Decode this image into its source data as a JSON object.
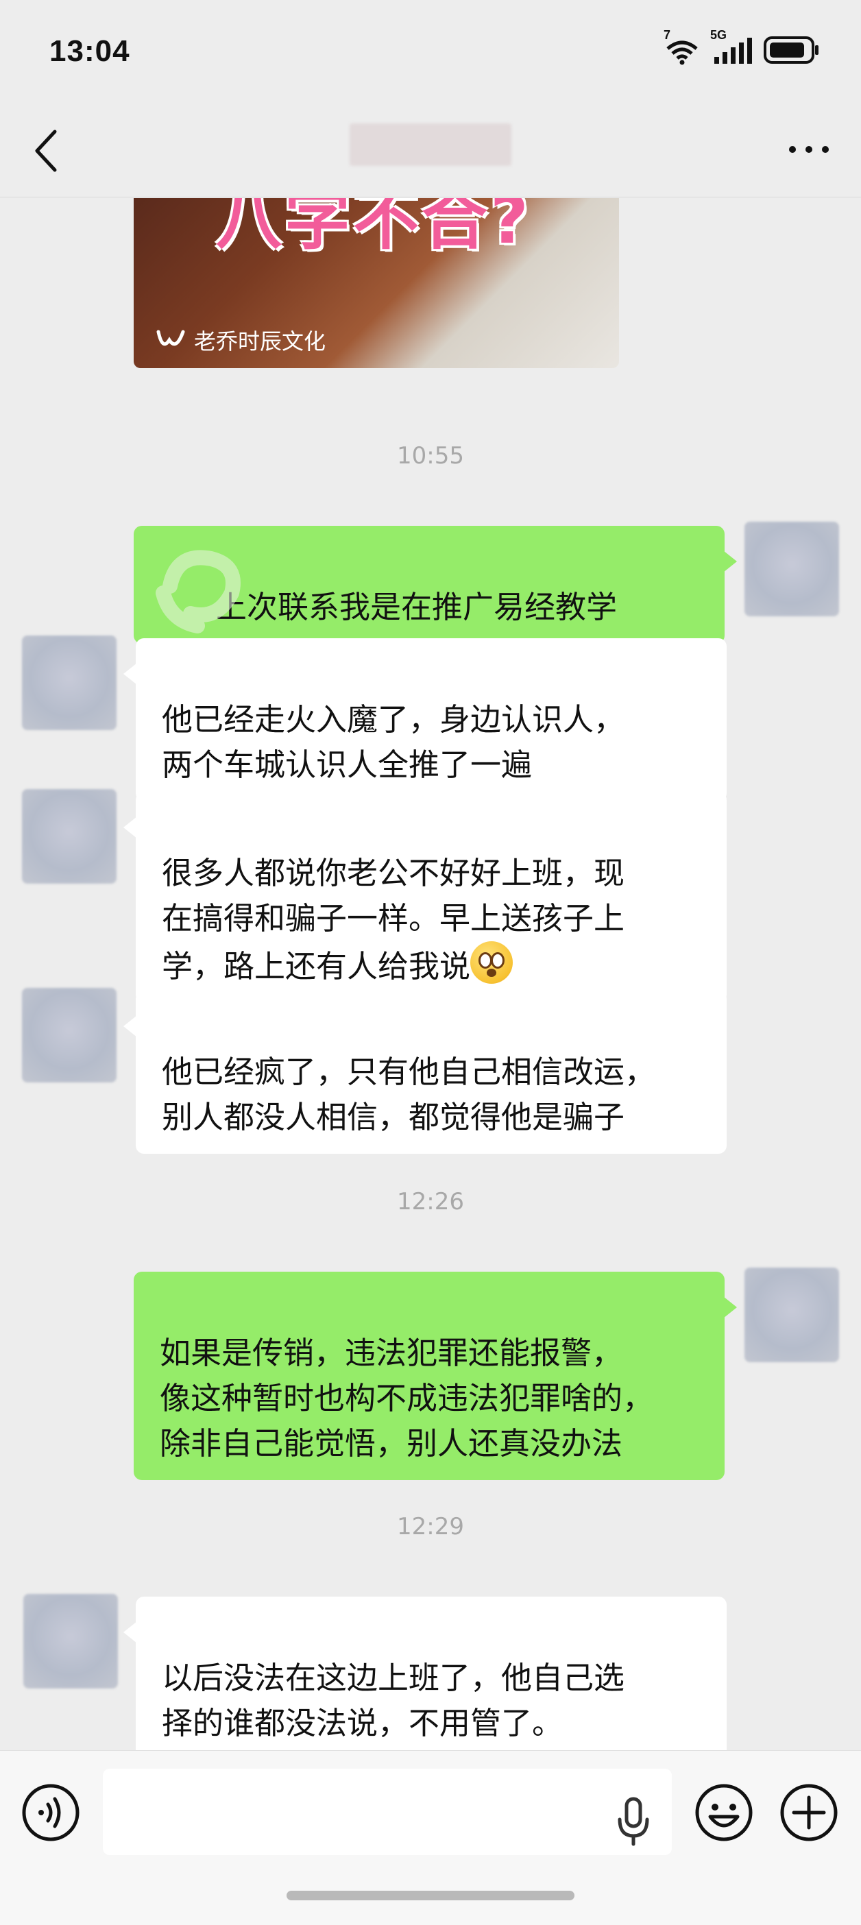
{
  "status_bar": {
    "time": "13:04",
    "wifi_label": "7",
    "network_label": "5G",
    "icons": [
      "wifi-icon",
      "signal-icon",
      "battery-icon"
    ]
  },
  "header": {
    "back_icon": "chevron-left-icon",
    "more_icon": "more-dots-icon"
  },
  "video_card": {
    "headline": "八字不合?",
    "source_name": "老乔时辰文化"
  },
  "messages": [
    {
      "type": "timestamp",
      "text": "10:55"
    },
    {
      "type": "outgoing",
      "text": "上次联系我是在推广易经教学"
    },
    {
      "type": "incoming",
      "text": "他已经走火入魔了，身边认识人，\n两个车城认识人全推了一遍"
    },
    {
      "type": "incoming",
      "text": "很多人都说你老公不好好上班，现\n在搞得和骗子一样。早上送孩子上\n学，路上还有人给我说"
    },
    {
      "type": "incoming",
      "text": "他已经疯了，只有他自己相信改运，\n别人都没人相信，都觉得他是骗子"
    },
    {
      "type": "timestamp",
      "text": "12:26"
    },
    {
      "type": "outgoing",
      "text": "如果是传销，违法犯罪还能报警，\n像这种暂时也构不成违法犯罪啥的，\n除非自己能觉悟，别人还真没办法"
    },
    {
      "type": "timestamp",
      "text": "12:29"
    },
    {
      "type": "incoming",
      "text": "以后没法在这边上班了，他自己选\n择的谁都没法说，不用管了。"
    }
  ],
  "input_bar": {
    "placeholder": "",
    "icons": [
      "voice-icon",
      "microphone-icon",
      "emoji-icon",
      "plus-icon"
    ]
  },
  "colors": {
    "background": "#ededed",
    "outgoing_bubble": "#95ec69",
    "incoming_bubble": "#ffffff",
    "timestamp_text": "#a8a8a8"
  }
}
